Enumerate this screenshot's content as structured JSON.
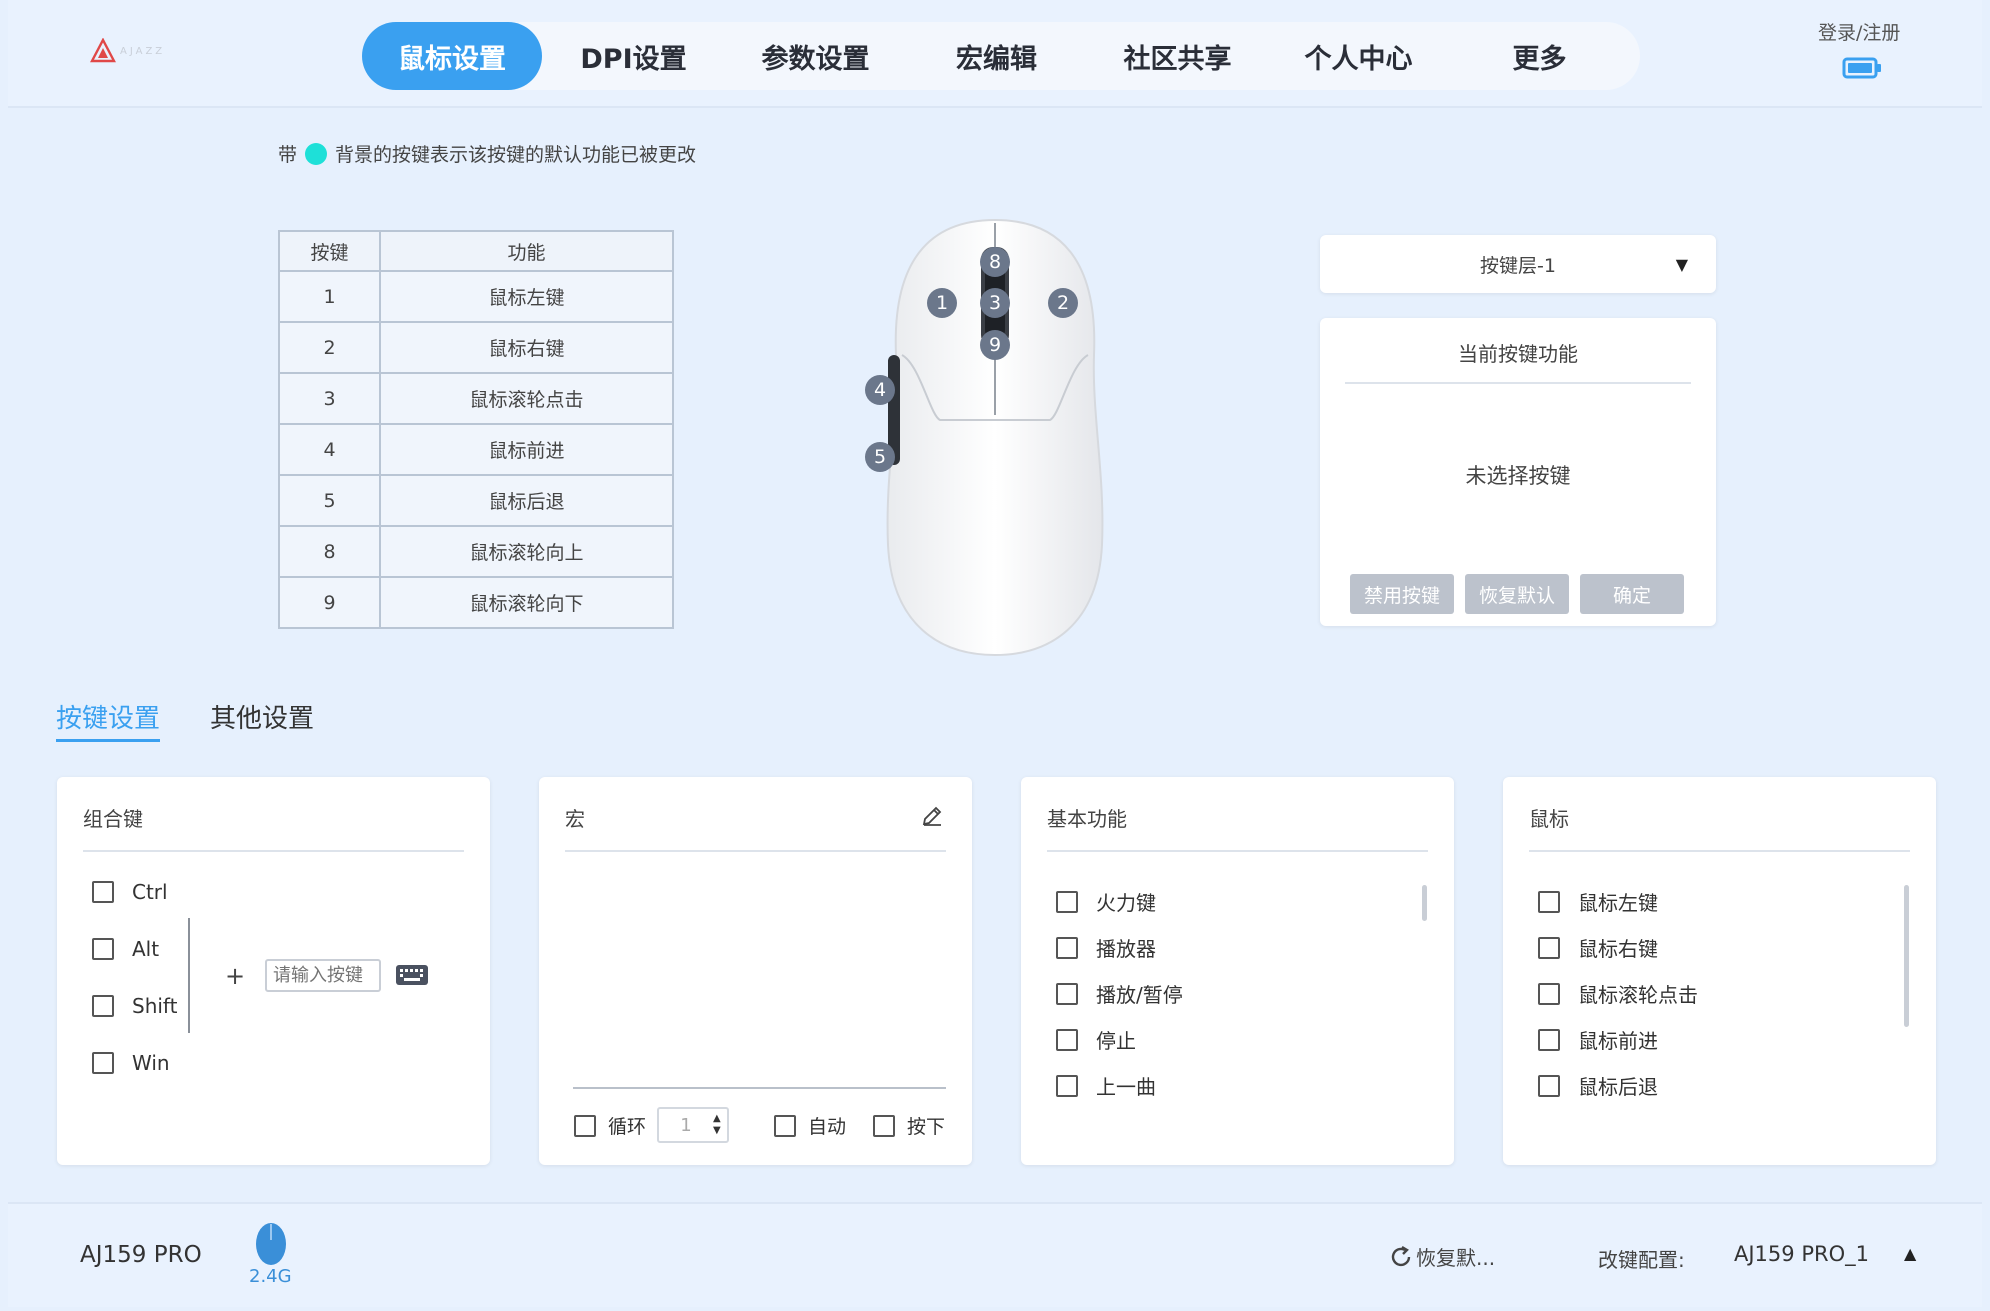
{
  "header": {
    "logo_text": "AJAZZ",
    "nav": [
      "鼠标设置",
      "DPI设置",
      "参数设置",
      "宏编辑",
      "社区共享",
      "个人中心",
      "更多"
    ],
    "active_nav": "鼠标设置",
    "login_label": "登录/注册"
  },
  "hint": {
    "prefix": "带",
    "suffix": "背景的按键表示该按键的默认功能已被更改"
  },
  "key_table": {
    "headers": [
      "按键",
      "功能"
    ],
    "rows": [
      [
        "1",
        "鼠标左键"
      ],
      [
        "2",
        "鼠标右键"
      ],
      [
        "3",
        "鼠标滚轮点击"
      ],
      [
        "4",
        "鼠标前进"
      ],
      [
        "5",
        "鼠标后退"
      ],
      [
        "8",
        "鼠标滚轮向上"
      ],
      [
        "9",
        "鼠标滚轮向下"
      ]
    ]
  },
  "mouse_buttons": [
    "8",
    "1",
    "3",
    "2",
    "9",
    "4",
    "5"
  ],
  "layer_select": {
    "value": "按键层-1"
  },
  "function_panel": {
    "title": "当前按键功能",
    "status": "未选择按键",
    "buttons": [
      "禁用按键",
      "恢复默认",
      "确定"
    ]
  },
  "tabs": [
    "按键设置",
    "其他设置"
  ],
  "combo_card": {
    "title": "组合键",
    "modifiers": [
      "Ctrl",
      "Alt",
      "Shift",
      "Win"
    ],
    "plus": "+",
    "input_placeholder": "请输入按键"
  },
  "macro_card": {
    "title": "宏",
    "loop_label": "循环",
    "loop_count": "1",
    "auto_label": "自动",
    "press_label": "按下"
  },
  "basic_card": {
    "title": "基本功能",
    "items": [
      "火力键",
      "播放器",
      "播放/暂停",
      "停止",
      "上一曲"
    ]
  },
  "mouse_card": {
    "title": "鼠标",
    "items": [
      "鼠标左键",
      "鼠标右键",
      "鼠标滚轮点击",
      "鼠标前进",
      "鼠标后退"
    ]
  },
  "footer": {
    "device_name": "AJ159 PRO",
    "connection": "2.4G",
    "restore_label": "恢复默...",
    "config_label": "改键配置:",
    "config_value": "AJ159 PRO_1"
  },
  "colors": {
    "accent": "#3aa0f0",
    "modified_indicator": "#1ee0d8",
    "disabled_button": "#bcc2cc"
  }
}
